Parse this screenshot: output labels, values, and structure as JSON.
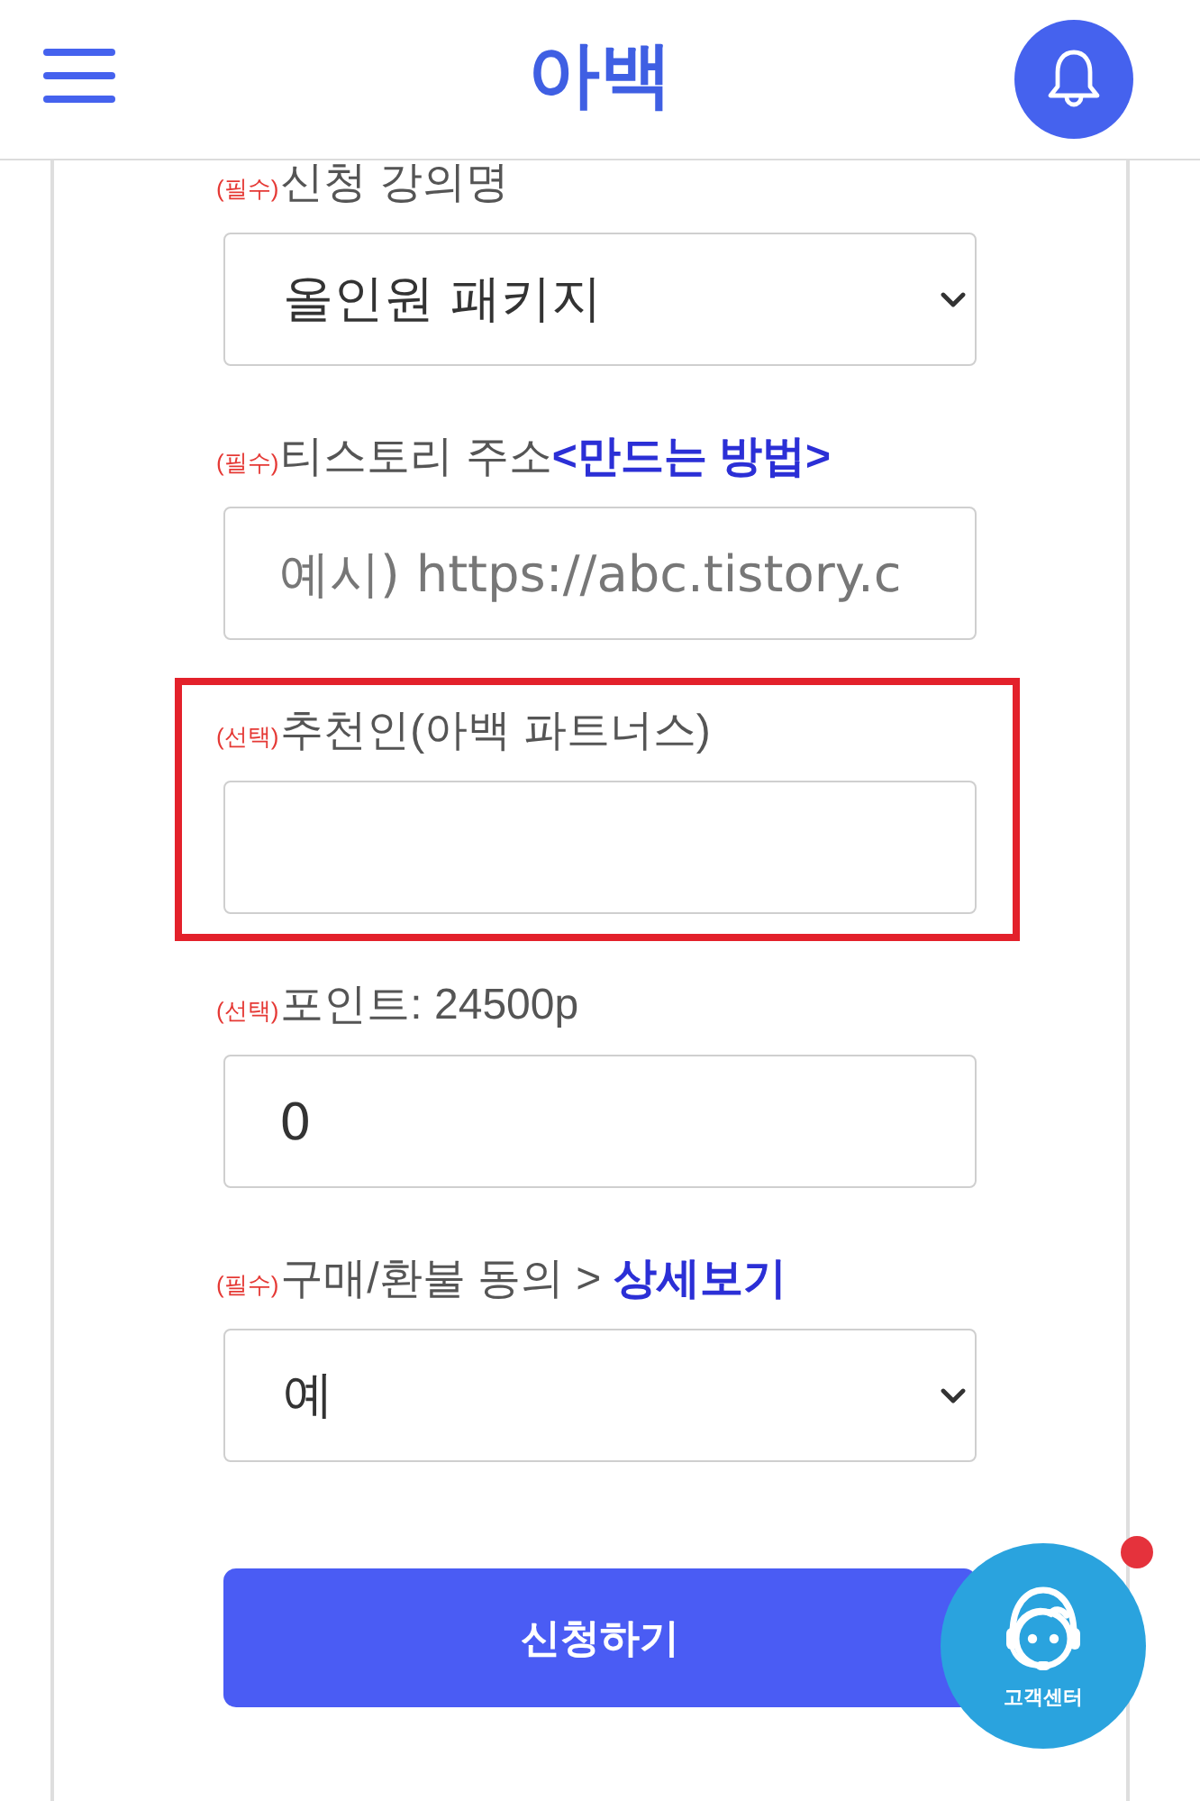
{
  "header": {
    "logo": "아백"
  },
  "form": {
    "fields": [
      {
        "kind": "select",
        "tag": "(필수)",
        "label": "신청 강의명",
        "value": "올인원 패키지",
        "highlighted": false
      },
      {
        "kind": "input",
        "tag": "(필수)",
        "label": "티스토리 주소",
        "link": "<만드는 방법>",
        "placeholder": "예시) https://abc.tistory.c",
        "highlighted": false
      },
      {
        "kind": "input",
        "tag": "(선택)",
        "label": "추천인(아백 파트너스)",
        "highlighted": true
      },
      {
        "kind": "input",
        "tag": "(선택)",
        "label": "포인트: 24500p",
        "value": "0",
        "highlighted": false
      },
      {
        "kind": "select",
        "tag": "(필수)",
        "label": "구매/환불 동의 >",
        "link": "상세보기",
        "value": "예",
        "highlighted": false
      }
    ],
    "submit_button": "신청하기"
  },
  "customer_center": {
    "label": "고객센터",
    "alert": true
  }
}
